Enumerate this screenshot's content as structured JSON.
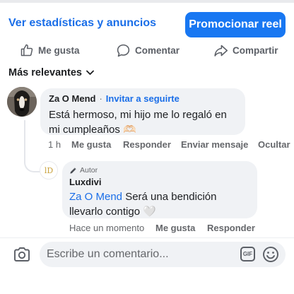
{
  "header": {
    "stats_link": "Ver estadísticas y anuncios",
    "promote_button": "Promocionar reel"
  },
  "actions": {
    "like": "Me gusta",
    "comment": "Comentar",
    "share": "Compartir"
  },
  "sort": {
    "label": "Más relevantes"
  },
  "comment": {
    "author": "Za O Mend",
    "separator": "·",
    "invite": "Invitar a seguirte",
    "text": "Está hermoso, mi hijo me lo regaló en mi cumpleaños 🫶🏻",
    "time": "1 h",
    "like": "Me gusta",
    "reply": "Responder",
    "message": "Enviar mensaje",
    "hide": "Ocultar"
  },
  "reply": {
    "avatar_text": "lD",
    "badge": "Autor",
    "author": "Luxdivi",
    "mention": "Za O Mend",
    "text": " Será una bendición llevarlo contigo 🤍",
    "time": "Hace un momento",
    "like": "Me gusta",
    "reply": "Responder"
  },
  "composer": {
    "placeholder": "Escribe un comentario...",
    "gif_label": "GIF"
  },
  "icons": {
    "like": "thumbs-up-icon",
    "comment": "speech-bubble-icon",
    "share": "share-arrow-icon",
    "sort": "chevron-down-icon",
    "author_badge": "pencil-icon",
    "camera": "camera-icon",
    "gif": "gif-icon",
    "emoji": "smiley-icon"
  },
  "colors": {
    "accent": "#1877f2",
    "link": "#1a6ee8",
    "bubble": "#f0f2f5",
    "muted_text": "#65676b"
  }
}
